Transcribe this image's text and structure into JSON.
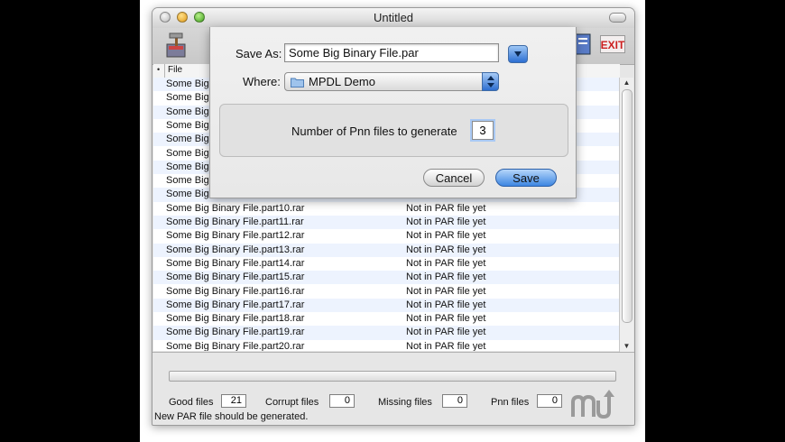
{
  "window": {
    "title": "Untitled"
  },
  "table": {
    "header": {
      "sort_marker": "•",
      "file_column": "File"
    },
    "rows": [
      {
        "file": "Some Big",
        "status": ""
      },
      {
        "file": "Some Big",
        "status": ""
      },
      {
        "file": "Some Big",
        "status": ""
      },
      {
        "file": "Some Big",
        "status": ""
      },
      {
        "file": "Some Big",
        "status": ""
      },
      {
        "file": "Some Big",
        "status": ""
      },
      {
        "file": "Some Big",
        "status": ""
      },
      {
        "file": "Some Big",
        "status": ""
      },
      {
        "file": "Some Big",
        "status": ""
      },
      {
        "file": "Some Big Binary File.part10.rar",
        "status": "Not in PAR file yet"
      },
      {
        "file": "Some Big Binary File.part11.rar",
        "status": "Not in PAR file yet"
      },
      {
        "file": "Some Big Binary File.part12.rar",
        "status": "Not in PAR file yet"
      },
      {
        "file": "Some Big Binary File.part13.rar",
        "status": "Not in PAR file yet"
      },
      {
        "file": "Some Big Binary File.part14.rar",
        "status": "Not in PAR file yet"
      },
      {
        "file": "Some Big Binary File.part15.rar",
        "status": "Not in PAR file yet"
      },
      {
        "file": "Some Big Binary File.part16.rar",
        "status": "Not in PAR file yet"
      },
      {
        "file": "Some Big Binary File.part17.rar",
        "status": "Not in PAR file yet"
      },
      {
        "file": "Some Big Binary File.part18.rar",
        "status": "Not in PAR file yet"
      },
      {
        "file": "Some Big Binary File.part19.rar",
        "status": "Not in PAR file yet"
      },
      {
        "file": "Some Big Binary File.part20.rar",
        "status": "Not in PAR file yet"
      }
    ]
  },
  "toolbar": {
    "exit_label": "EXIT"
  },
  "stats": {
    "good_label": "Good files",
    "good_value": "21",
    "corrupt_label": "Corrupt files",
    "corrupt_value": "0",
    "missing_label": "Missing files",
    "missing_value": "0",
    "pnn_label": "Pnn files",
    "pnn_value": "0"
  },
  "status_message": "New PAR file should be generated.",
  "dialog": {
    "save_as_label": "Save As:",
    "save_as_value": "Some Big Binary File.par",
    "where_label": "Where:",
    "where_value": "MPDL Demo",
    "pnn_label": "Number of Pnn files to generate",
    "pnn_value": "3",
    "cancel_label": "Cancel",
    "save_label": "Save"
  },
  "colors": {
    "accent": "#3d86e2",
    "row_alt": "#edf3fe",
    "exit_red": "#cc1f1f"
  }
}
